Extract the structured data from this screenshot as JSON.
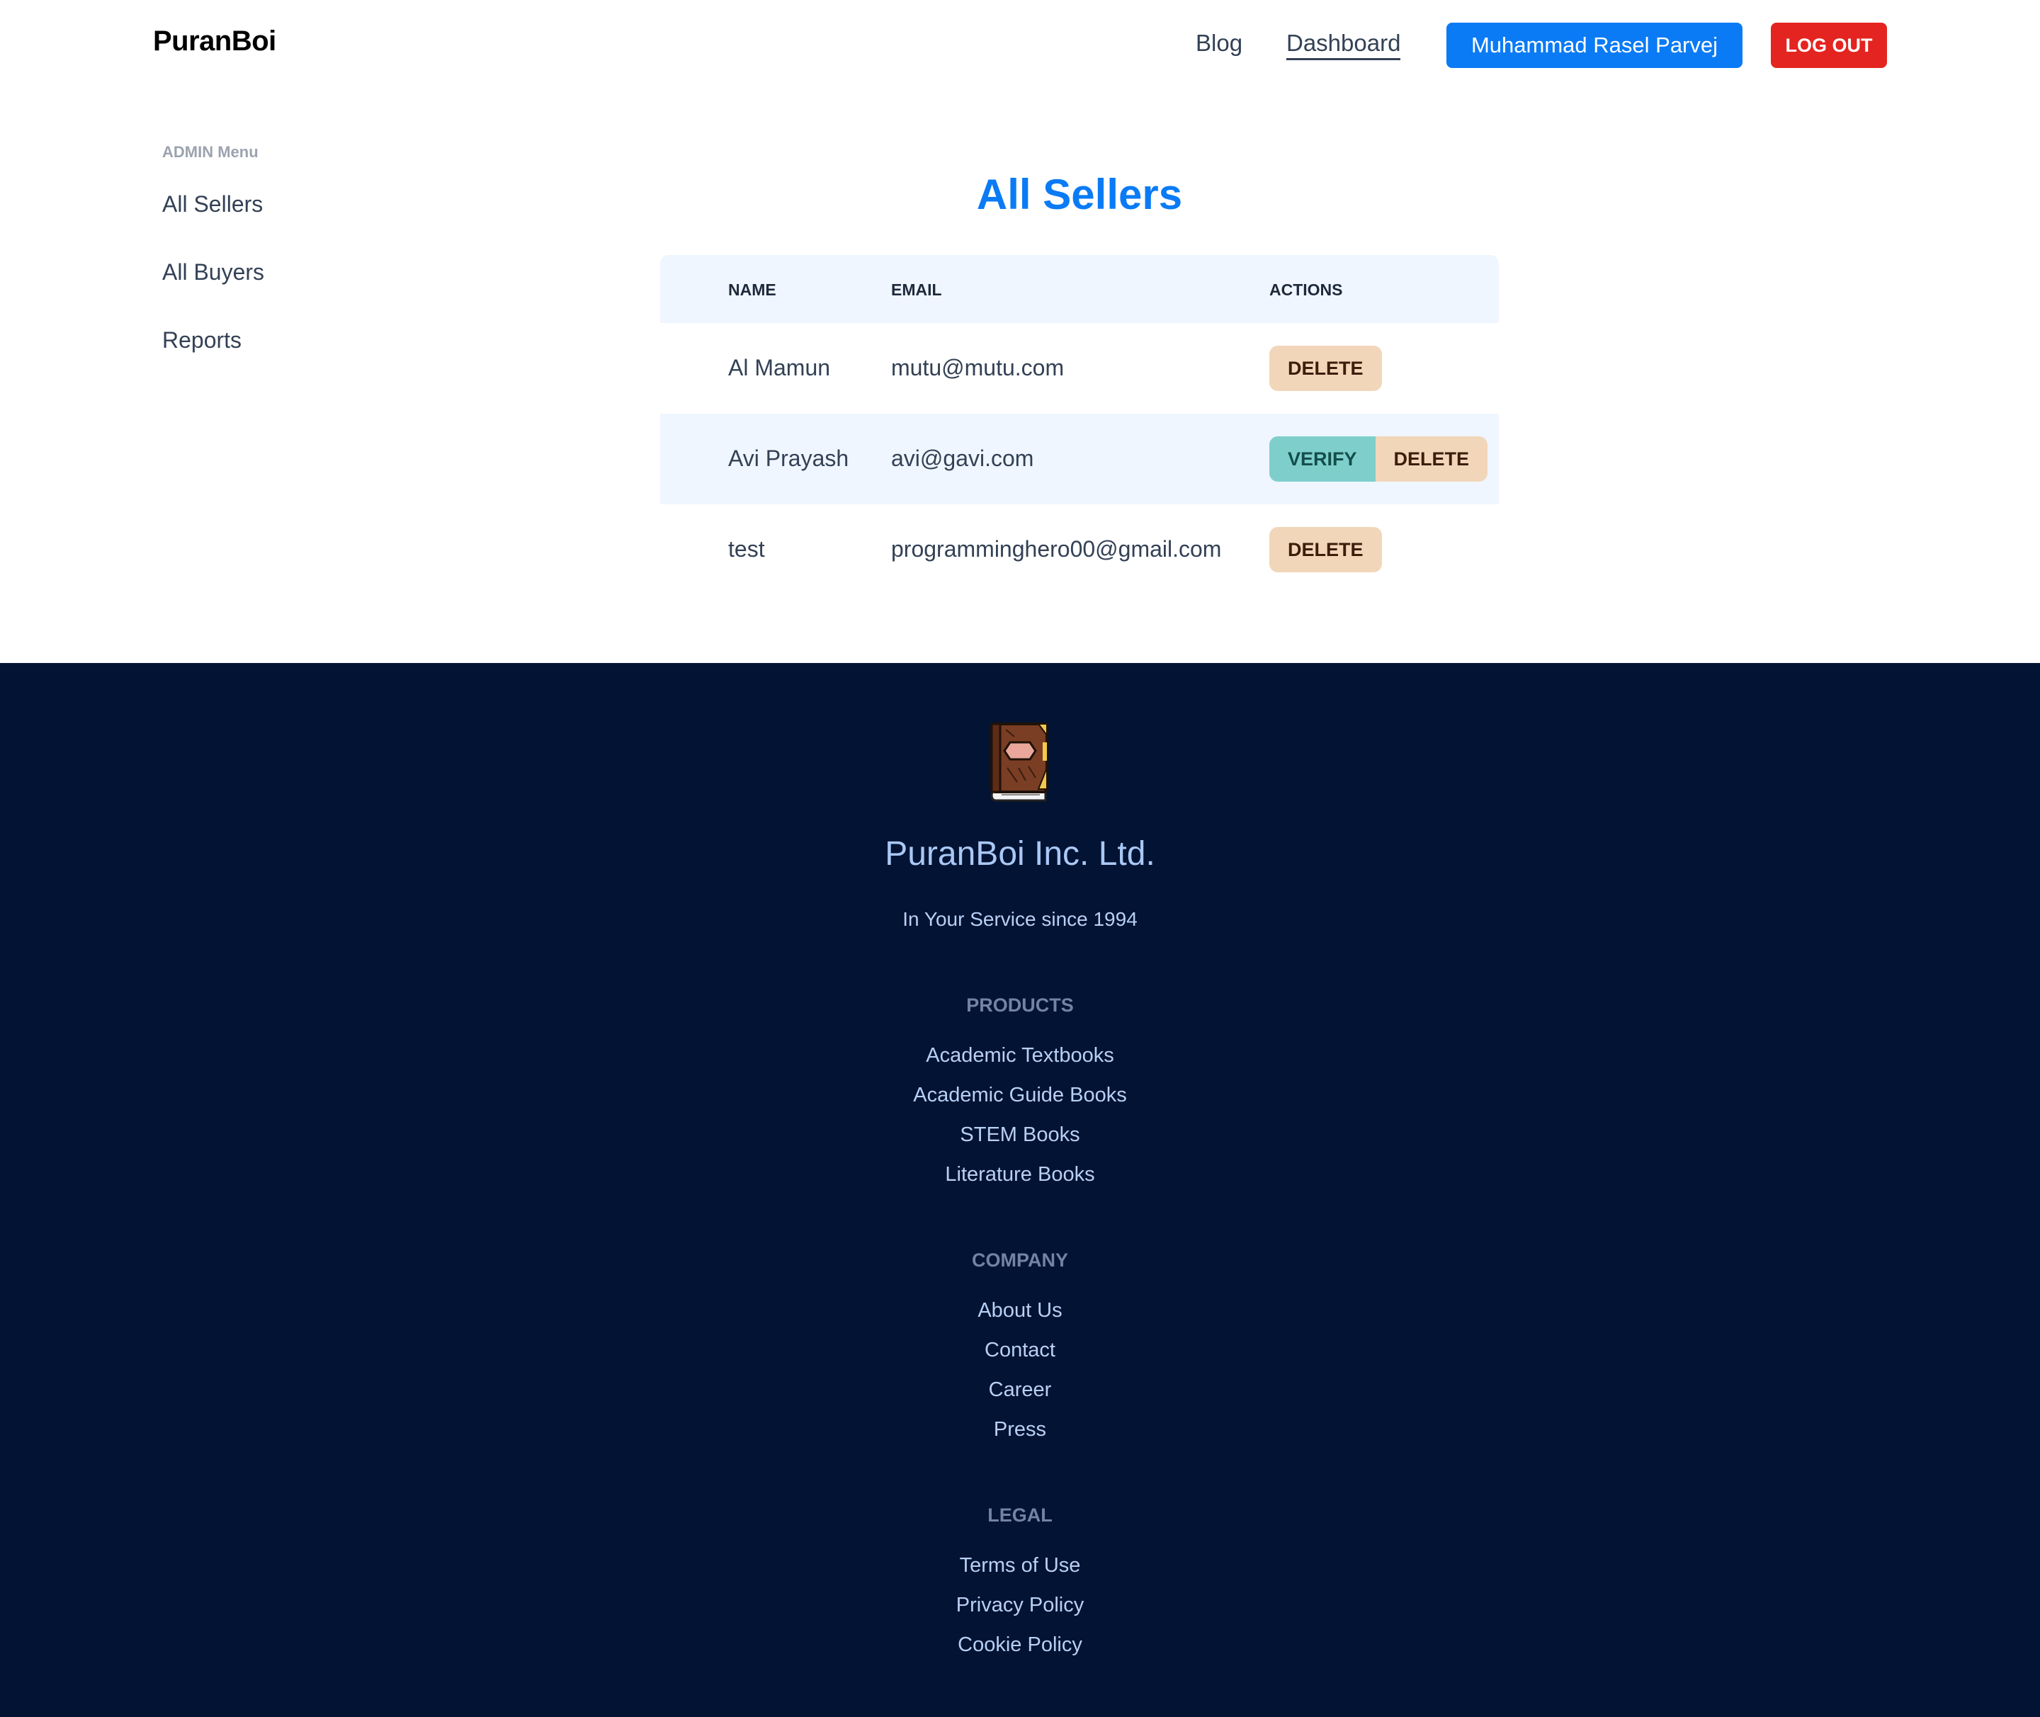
{
  "navbar": {
    "brand": "PuranBoi",
    "links": [
      "Blog",
      "Dashboard"
    ],
    "user_name": "Muhammad Rasel Parvej",
    "logout_label": "LOG OUT"
  },
  "sidebar": {
    "heading": "ADMIN Menu",
    "items": [
      "All Sellers",
      "All Buyers",
      "Reports"
    ]
  },
  "main": {
    "title": "All Sellers",
    "table": {
      "headers": [
        "NAME",
        "EMAIL",
        "ACTIONS"
      ],
      "rows": [
        {
          "name": "Al Mamun",
          "email": "mutu@mutu.com",
          "verify_label": null,
          "delete_label": "DELETE"
        },
        {
          "name": "Avi Prayash",
          "email": "avi@gavi.com",
          "verify_label": "VERIFY",
          "delete_label": "DELETE"
        },
        {
          "name": "test",
          "email": "programminghero00@gmail.com",
          "verify_label": null,
          "delete_label": "DELETE"
        }
      ]
    }
  },
  "footer": {
    "logo_icon": "book-icon",
    "company": "PuranBoi Inc. Ltd.",
    "tagline": "In Your Service since 1994",
    "sections": [
      {
        "heading": "PRODUCTS",
        "links": [
          "Academic Textbooks",
          "Academic Guide Books",
          "STEM Books",
          "Literature Books"
        ]
      },
      {
        "heading": "COMPANY",
        "links": [
          "About Us",
          "Contact",
          "Career",
          "Press"
        ]
      },
      {
        "heading": "LEGAL",
        "links": [
          "Terms of Use",
          "Privacy Policy",
          "Cookie Policy"
        ]
      }
    ]
  },
  "colors": {
    "accent": "#0a7bf5",
    "logout": "#e42420",
    "footer_bg": "#031333",
    "row_alt": "#eff6ff",
    "verify_bg": "#7ecfcc",
    "delete_bg": "#f2d6b9"
  }
}
